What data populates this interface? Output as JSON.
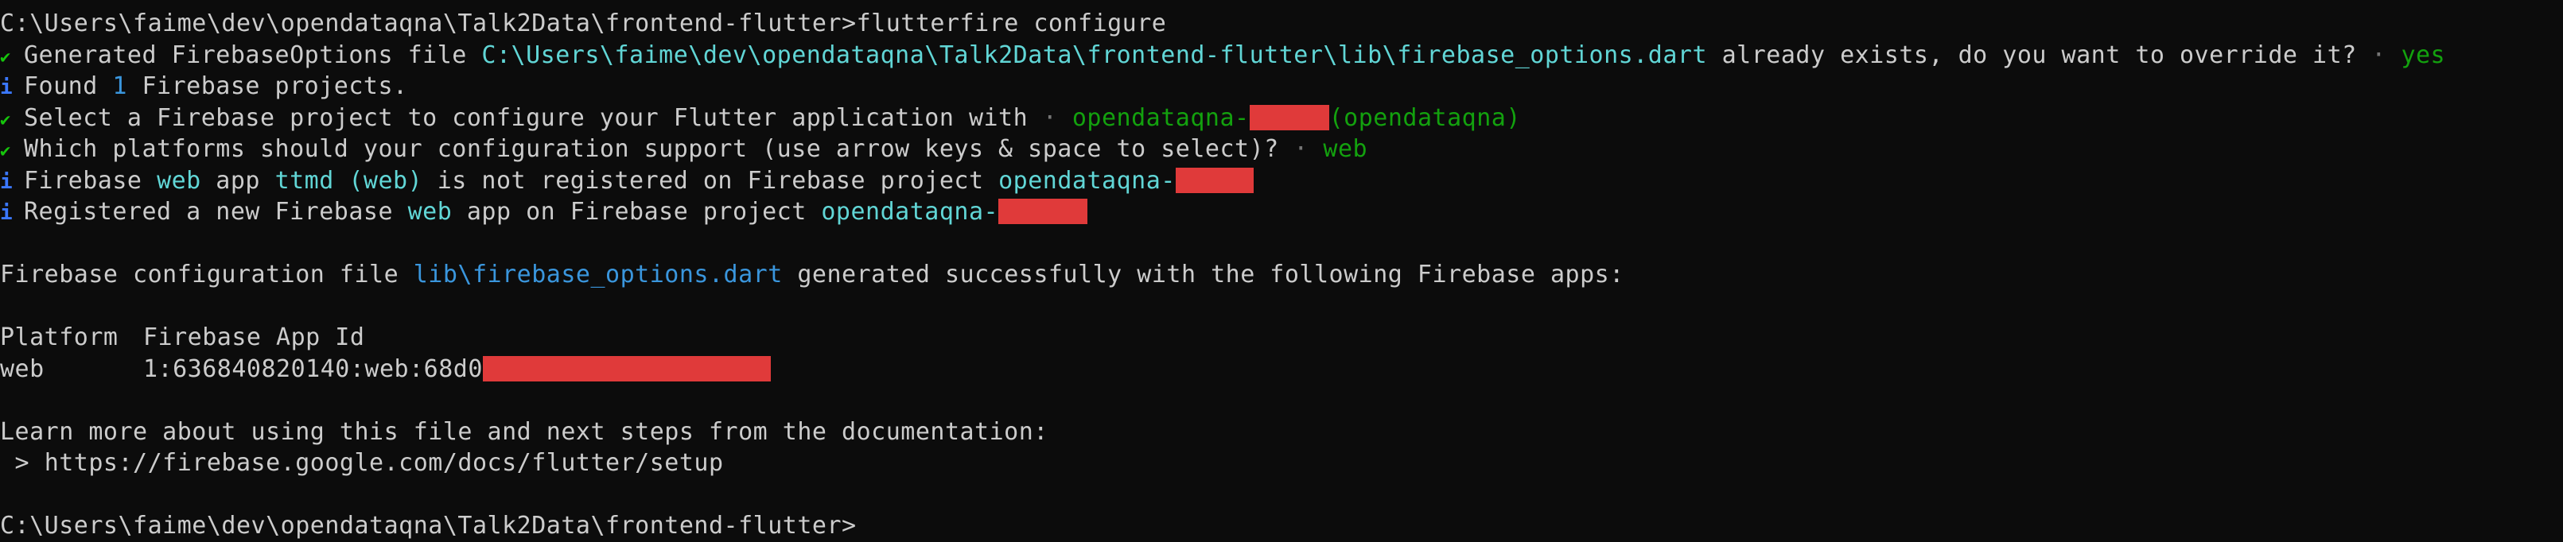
{
  "prompt": {
    "path": "C:\\Users\\faime\\dev\\opendataqna\\Talk2Data\\frontend-flutter>",
    "command": "flutterfire configure"
  },
  "lines": {
    "l1_prefix": "Generated FirebaseOptions file ",
    "l1_path": "C:\\Users\\faime\\dev\\opendataqna\\Talk2Data\\frontend-flutter\\lib\\firebase_options.dart",
    "l1_suffix": " already exists, do you want to override it?",
    "l1_sep": " · ",
    "l1_answer": "yes",
    "l2_found": "Found ",
    "l2_count": "1",
    "l2_rest": " Firebase projects.",
    "l3_prefix": "Select a Firebase project to configure your Flutter application with",
    "l3_sep": " · ",
    "l3_project": "opendataqna-",
    "l3_project_suffix": "(opendataqna)",
    "l4_prefix": "Which platforms should your configuration support (use arrow keys & space to select)?",
    "l4_sep": " · ",
    "l4_answer": "web",
    "l5_a": "Firebase ",
    "l5_web": "web",
    "l5_b": " app ",
    "l5_app": "ttmd (web)",
    "l5_c": " is not registered on Firebase project ",
    "l5_project": "opendataqna-",
    "l6_a": "Registered a new Firebase ",
    "l6_web": "web",
    "l6_b": " app on Firebase project ",
    "l6_project": "opendataqna-",
    "l7_a": "Firebase configuration file ",
    "l7_file": "lib\\firebase_options.dart",
    "l7_b": " generated successfully with the following Firebase apps:",
    "table_header_platform": "Platform",
    "table_header_appid": "Firebase App Id",
    "table_row_platform": "web",
    "table_row_appid": "1:636840820140:web:68d0",
    "learn_more": "Learn more about using this file and next steps from the documentation:",
    "docs_arrow": " > ",
    "docs_url": "https://firebase.google.com/docs/flutter/setup"
  },
  "final_prompt": "C:\\Users\\faime\\dev\\opendataqna\\Talk2Data\\frontend-flutter>",
  "colors": {
    "background": "#0c0c0c",
    "text": "#cccccc",
    "path_cyan": "#61d6d6",
    "answer_green": "#13a10e",
    "check_green": "#16c60c",
    "info_blue": "#3b78ff",
    "redaction": "#e03a3a"
  },
  "icons": {
    "check": "check-icon",
    "info": "info-icon"
  }
}
